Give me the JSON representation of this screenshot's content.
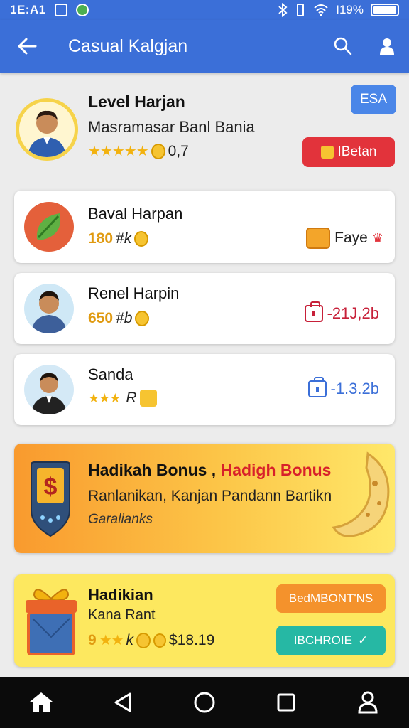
{
  "status_bar": {
    "time": "1E:A1",
    "battery_text": "I19%",
    "icons": [
      "gallery-icon",
      "whatsapp-icon",
      "bluetooth-icon",
      "vibrate-icon",
      "wifi-icon",
      "battery-icon"
    ]
  },
  "app_bar": {
    "title": "Casual Kalgjan",
    "back_icon": "arrow-left-icon",
    "actions": [
      "search-icon",
      "profile-icon"
    ]
  },
  "profile": {
    "name": "Level Harjan",
    "subtitle": "Masramasar Banl Bania",
    "rating": "0,7",
    "stars": 5,
    "badge_label": "ESA",
    "action_label": "IBetan",
    "colors": {
      "badge": "#4a86e8",
      "action": "#e2333b"
    }
  },
  "players": [
    {
      "name": "Baval Harpan",
      "score": "180",
      "unit": "#k",
      "delta": "Faye",
      "delta_color": "#e0641a",
      "avatar": "leaf-avatar"
    },
    {
      "name": "Renel Harpin",
      "score": "650",
      "unit": "#b",
      "delta": "-21J,2b",
      "delta_color": "#c72039",
      "avatar": "man-avatar"
    },
    {
      "name": "Sanda",
      "score": "",
      "unit": "R",
      "delta": "-1.3.2b",
      "delta_color": "#3b6fd8",
      "avatar": "man-suit-avatar"
    }
  ],
  "bonus": {
    "title_part1": "Hadikah Bonus ,",
    "title_part2": "Hadigh Bonus",
    "line1": "Ranlanikan, Kanjan Pandann Bartikn",
    "line2": "Garalianks",
    "icon": "phone-dollar-icon",
    "art": "cookie-icon"
  },
  "gift": {
    "title": "Hadikian",
    "subtitle": "Kana Rant",
    "rating": "9",
    "unit": "k",
    "price": "$18.19",
    "primary_button": "BedMBONT'NS",
    "secondary_button": "IBCHROIE",
    "icon": "gift-box-icon",
    "colors": {
      "primary": "#f4922c",
      "secondary": "#26b8a4"
    }
  },
  "nav": [
    "home-icon",
    "back-triangle-icon",
    "home-circle-icon",
    "recents-icon",
    "person-icon"
  ]
}
